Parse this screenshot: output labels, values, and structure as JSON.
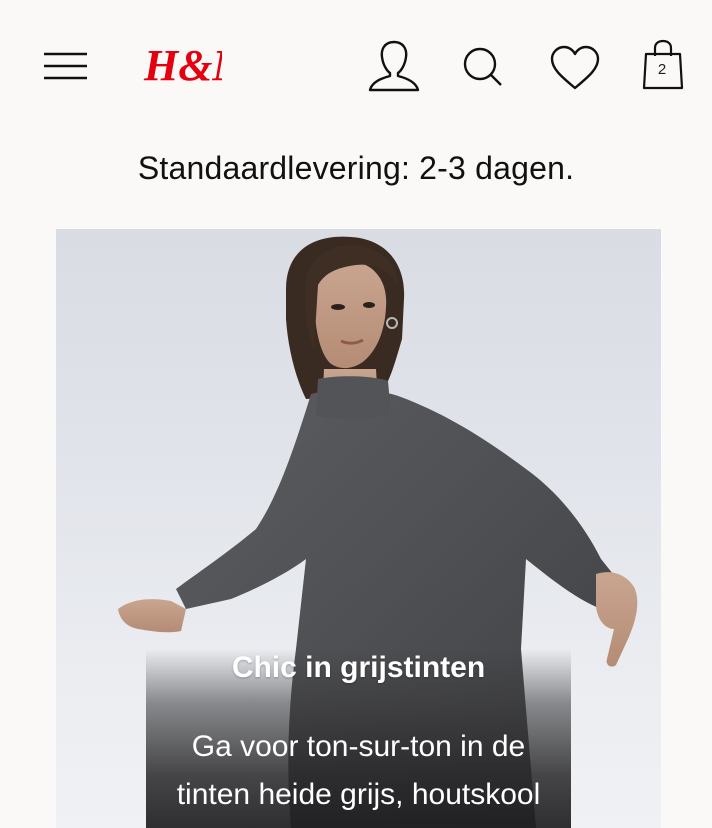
{
  "header": {
    "brand": "H&M",
    "bag_count": "2",
    "icons": {
      "menu": "hamburger-menu-icon",
      "account": "user-icon",
      "search": "search-icon",
      "wishlist": "heart-icon",
      "bag": "shopping-bag-icon"
    },
    "brand_color": "#e50010"
  },
  "notice": {
    "text": "Standaardlevering: 2-3 dagen."
  },
  "hero": {
    "title": "Chic in grijstinten",
    "body_line_1": "Ga voor ton-sur-ton in de",
    "body_line_2": "tinten heide grijs, houtskool"
  }
}
